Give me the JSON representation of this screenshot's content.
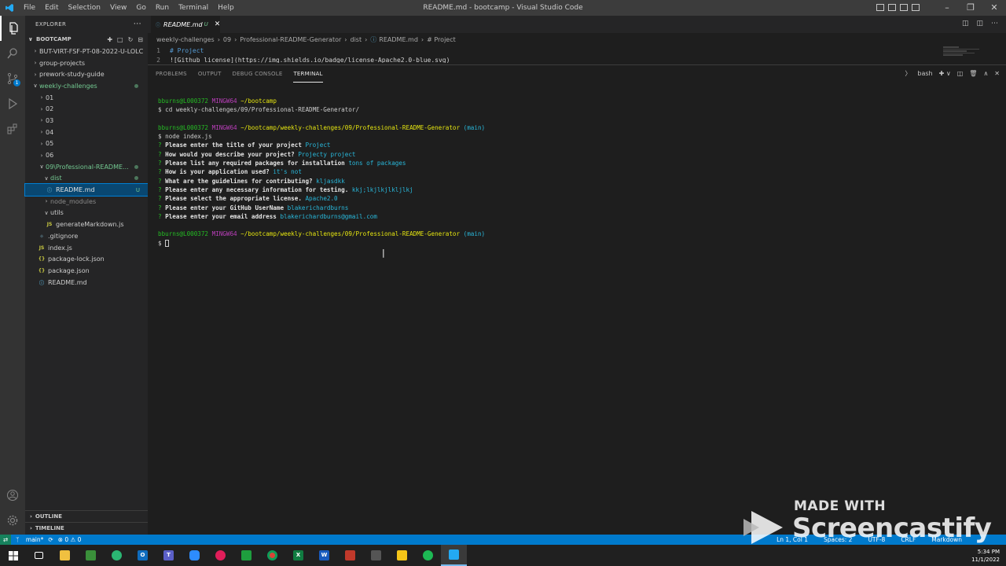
{
  "window": {
    "title": "README.md - bootcamp - Visual Studio Code",
    "menu": [
      "File",
      "Edit",
      "Selection",
      "View",
      "Go",
      "Run",
      "Terminal",
      "Help"
    ]
  },
  "activity": {
    "scm_badge": "1"
  },
  "sidebar": {
    "header": "EXPLORER",
    "section": "BOOTCAMP",
    "items": [
      {
        "label": "BUT-VIRT-FSF-PT-08-2022-U-LOLC",
        "type": "folder"
      },
      {
        "label": "group-projects",
        "type": "folder"
      },
      {
        "label": "prework-study-guide",
        "type": "folder"
      },
      {
        "label": "weekly-challenges",
        "type": "folder-open"
      },
      {
        "label": "01",
        "type": "folder"
      },
      {
        "label": "02",
        "type": "folder"
      },
      {
        "label": "03",
        "type": "folder"
      },
      {
        "label": "04",
        "type": "folder"
      },
      {
        "label": "05",
        "type": "folder"
      },
      {
        "label": "06",
        "type": "folder"
      },
      {
        "label": "09\\Professional-README...",
        "type": "folder-open"
      },
      {
        "label": "dist",
        "type": "folder-open"
      },
      {
        "label": "README.md",
        "type": "md",
        "badge": "U"
      },
      {
        "label": "node_modules",
        "type": "folder"
      },
      {
        "label": "utils",
        "type": "folder-open"
      },
      {
        "label": "generateMarkdown.js",
        "type": "js"
      },
      {
        "label": ".gitignore",
        "type": "git"
      },
      {
        "label": "index.js",
        "type": "js"
      },
      {
        "label": "package-lock.json",
        "type": "json"
      },
      {
        "label": "package.json",
        "type": "json"
      },
      {
        "label": "README.md",
        "type": "md"
      }
    ],
    "outline": "OUTLINE",
    "timeline": "TIMELINE"
  },
  "editor": {
    "tab_label": "README.md",
    "tab_badge": "U",
    "breadcrumb": [
      "weekly-challenges",
      "09",
      "Professional-README-Generator",
      "dist",
      "README.md",
      "# Project"
    ],
    "lines": [
      {
        "n": "1",
        "text": "# Project"
      },
      {
        "n": "2",
        "text": "  ![Github license](https://img.shields.io/badge/license-Apache2.0-blue.svg)"
      }
    ]
  },
  "panel": {
    "tabs": [
      "PROBLEMS",
      "OUTPUT",
      "DEBUG CONSOLE",
      "TERMINAL"
    ],
    "active_tab": "TERMINAL",
    "shell": "bash",
    "terminal": {
      "user": "bburns@L000372",
      "host": "MINGW64",
      "path1": "~/bootcamp",
      "cmd1": "$ cd weekly-challenges/09/Professional-README-Generator/",
      "path2": "~/bootcamp/weekly-challenges/09/Professional-README-Generator",
      "branch": "(main)",
      "cmd2": "$ node index.js",
      "qa": [
        {
          "q": "Please enter the title of your project",
          "a": "Project"
        },
        {
          "q": "How would you describe your project?",
          "a": "Projecty project"
        },
        {
          "q": "Please list any required packages for installation",
          "a": "tons of packages"
        },
        {
          "q": "How is your application used?",
          "a": "it's not"
        },
        {
          "q": "What are the guidelines for contributing?",
          "a": "kljasdkk"
        },
        {
          "q": "Please enter any necessary information for testing.",
          "a": "kkj;lkjlkjlkljlkj"
        },
        {
          "q": "Please select the appropriate license.",
          "a": "Apache2.0"
        },
        {
          "q": "Please enter your GitHub UserName",
          "a": "blakerichardburns"
        },
        {
          "q": "Please enter your email address",
          "a": "blakerichardburns@gmail.com"
        }
      ],
      "prompt": "$"
    }
  },
  "statusbar": {
    "branch": "main*",
    "sync": "⟳",
    "problems": "⊗ 0 ⚠ 0",
    "right": [
      "Ln 1, Col 1",
      "Spaces: 2",
      "UTF-8",
      "CRLF",
      "Markdown"
    ]
  },
  "taskbar": {
    "time": "5:34 PM",
    "date": "11/1/2022"
  },
  "watermark": {
    "made_with": "MADE WITH",
    "brand": "Screencastify"
  },
  "colors": {
    "accent": "#007acc",
    "terminal_green": "#25bc24",
    "terminal_magenta": "#bc3fbc",
    "terminal_yellow": "#e5e510",
    "terminal_cyan": "#29b8db"
  }
}
